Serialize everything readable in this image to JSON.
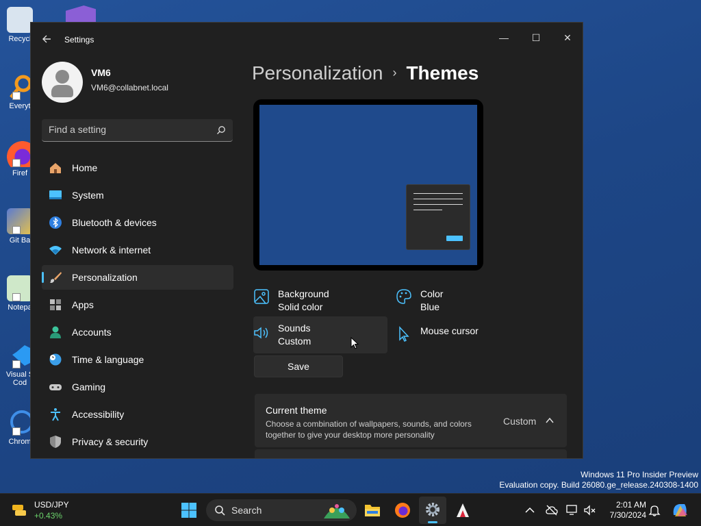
{
  "desktop": {
    "icons": [
      {
        "label": "Recycl"
      },
      {
        "label": "Everyt"
      },
      {
        "label": "Firef"
      },
      {
        "label": "Git Ba"
      },
      {
        "label": "Notepa"
      },
      {
        "label": "Visual S Cod"
      },
      {
        "label": "Chrom"
      }
    ],
    "watermark": {
      "line1": "Windows 11 Pro Insider Preview",
      "line2": "Evaluation copy. Build 26080.ge_release.240308-1400"
    }
  },
  "window": {
    "title": "Settings",
    "controls": {
      "minimize": "—",
      "maximize": "☐",
      "close": "✕"
    }
  },
  "profile": {
    "name": "VM6",
    "email": "VM6@collabnet.local"
  },
  "search": {
    "placeholder": "Find a setting"
  },
  "sidebar": {
    "items": [
      {
        "label": "Home",
        "icon": "home-icon"
      },
      {
        "label": "System",
        "icon": "system-icon"
      },
      {
        "label": "Bluetooth & devices",
        "icon": "bluetooth-icon"
      },
      {
        "label": "Network & internet",
        "icon": "wifi-icon"
      },
      {
        "label": "Personalization",
        "icon": "brush-icon",
        "active": true
      },
      {
        "label": "Apps",
        "icon": "apps-icon"
      },
      {
        "label": "Accounts",
        "icon": "accounts-icon"
      },
      {
        "label": "Time & language",
        "icon": "globe-clock-icon"
      },
      {
        "label": "Gaming",
        "icon": "gamepad-icon"
      },
      {
        "label": "Accessibility",
        "icon": "accessibility-icon"
      },
      {
        "label": "Privacy & security",
        "icon": "shield-icon"
      }
    ]
  },
  "main": {
    "breadcrumb": {
      "parent": "Personalization",
      "separator": "›",
      "current": "Themes"
    },
    "options": {
      "background": {
        "title": "Background",
        "value": "Solid color"
      },
      "color": {
        "title": "Color",
        "value": "Blue"
      },
      "sounds": {
        "title": "Sounds",
        "value": "Custom"
      },
      "mouse_cursor": {
        "title": "Mouse cursor"
      }
    },
    "save_label": "Save",
    "current_theme": {
      "title": "Current theme",
      "description": "Choose a combination of wallpapers, sounds, and colors together to give your desktop more personality",
      "value": "Custom"
    }
  },
  "taskbar": {
    "widget": {
      "title": "USD/JPY",
      "change": "+0.43%"
    },
    "search_label": "Search",
    "clock": {
      "time": "2:01 AM",
      "date": "7/30/2024"
    }
  },
  "colors": {
    "accent": "#4cc2ff",
    "window_bg": "#202020",
    "desktop_bg": "#1f4a8c",
    "card_bg": "#2b2b2b"
  }
}
